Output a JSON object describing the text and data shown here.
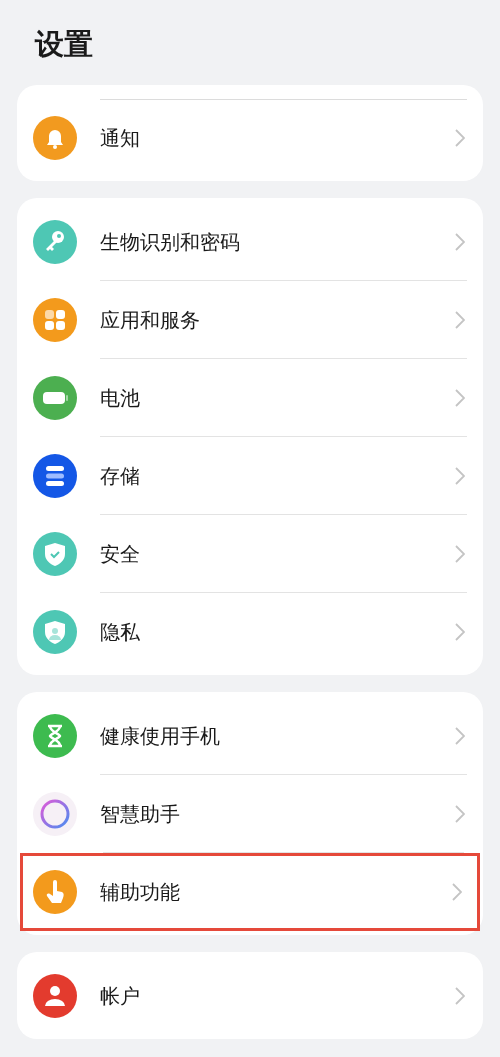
{
  "title": "设置",
  "groups": [
    {
      "items": [
        {
          "kind": "bell",
          "label": "通知",
          "highlighted": false
        }
      ]
    },
    {
      "items": [
        {
          "kind": "key",
          "label": "生物识别和密码",
          "highlighted": false
        },
        {
          "kind": "apps",
          "label": "应用和服务",
          "highlighted": false
        },
        {
          "kind": "battery",
          "label": "电池",
          "highlighted": false
        },
        {
          "kind": "storage",
          "label": "存储",
          "highlighted": false
        },
        {
          "kind": "shield",
          "label": "安全",
          "highlighted": false
        },
        {
          "kind": "privacy",
          "label": "隐私",
          "highlighted": false
        }
      ]
    },
    {
      "items": [
        {
          "kind": "hourglass",
          "label": "健康使用手机",
          "highlighted": false
        },
        {
          "kind": "ring",
          "label": "智慧助手",
          "highlighted": false
        },
        {
          "kind": "hand",
          "label": "辅助功能",
          "highlighted": true
        }
      ]
    },
    {
      "items": [
        {
          "kind": "person",
          "label": "帐户",
          "highlighted": false
        }
      ]
    }
  ]
}
